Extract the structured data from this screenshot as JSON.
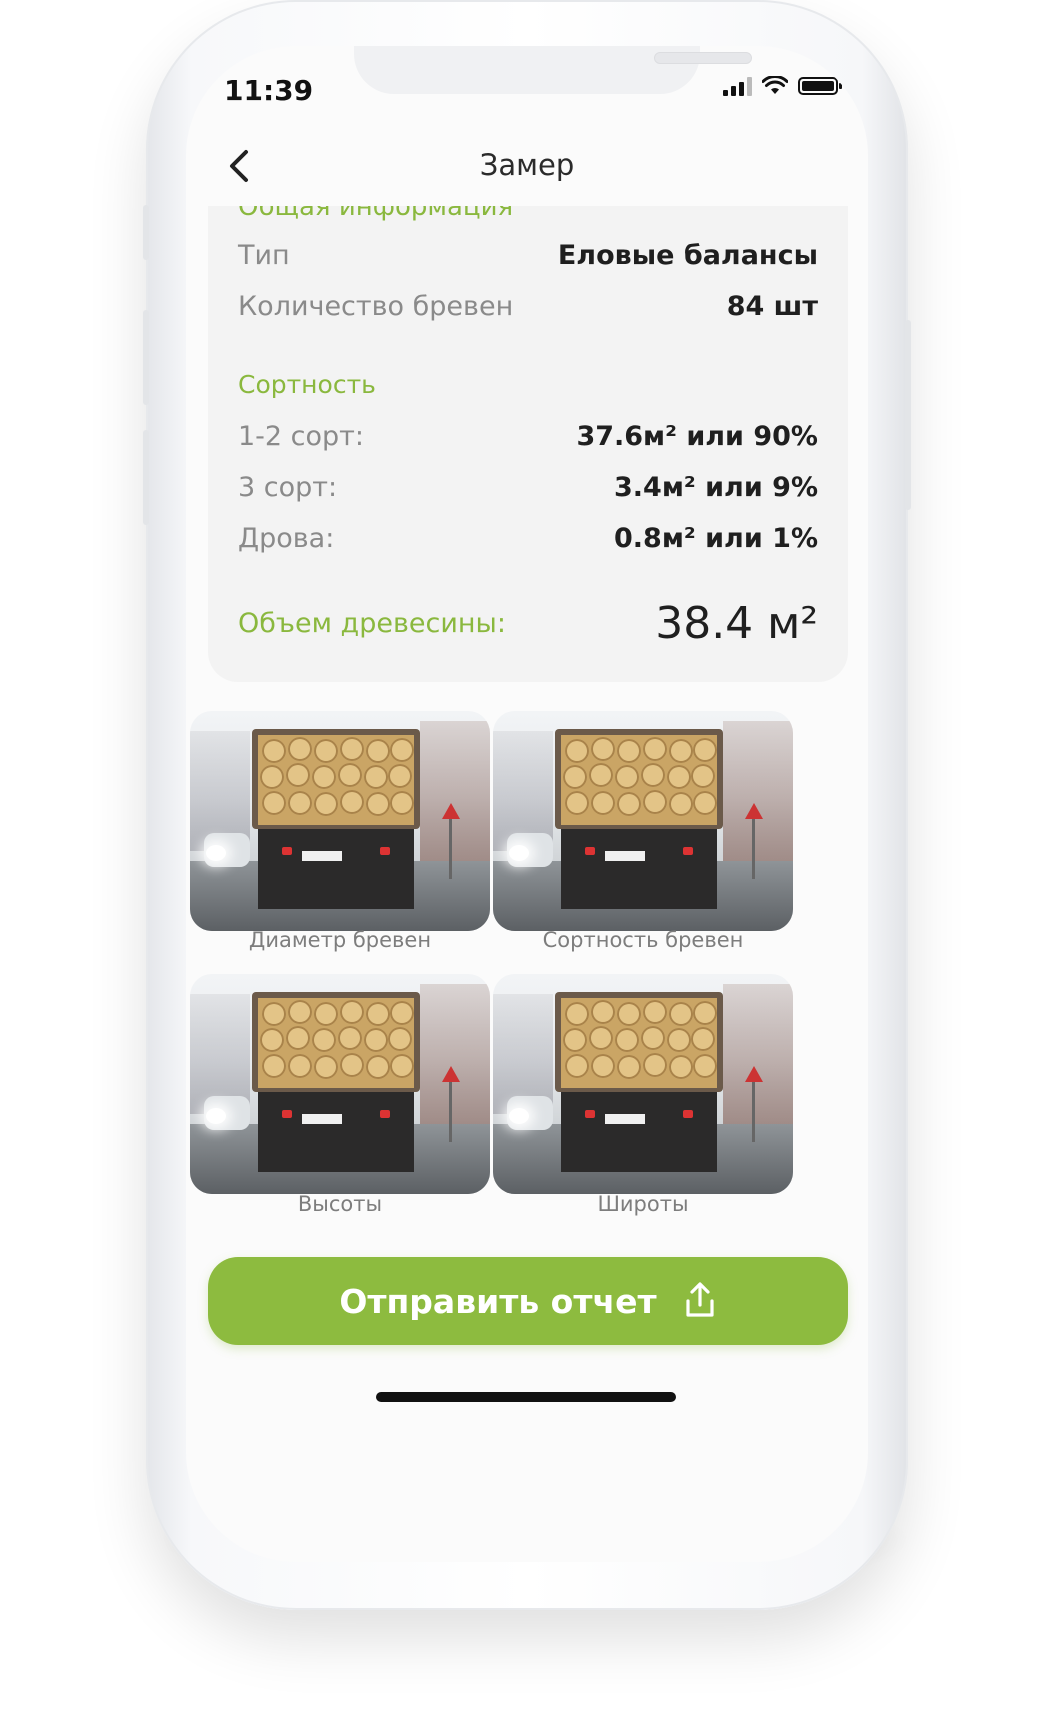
{
  "status_bar": {
    "time": "11:39"
  },
  "header": {
    "title": "Замер"
  },
  "card": {
    "section_title": "Общая информация",
    "rows": [
      {
        "label": "Тип",
        "value": "Еловые балансы"
      },
      {
        "label": "Количество бревен",
        "value": "84 шт"
      }
    ],
    "grade_title": "Сортность",
    "grades": [
      {
        "label": "1-2 сорт:",
        "value": "37.6м² или 90%"
      },
      {
        "label": "3 сорт:",
        "value": "3.4м² или 9%"
      },
      {
        "label": "Дрова:",
        "value": "0.8м² или 1%"
      }
    ],
    "volume": {
      "label": "Объем древесины:",
      "value": "38.4 м²"
    }
  },
  "photos": [
    {
      "caption": "Диаметр бревен"
    },
    {
      "caption": "Сортность бревен"
    },
    {
      "caption": "Высоты"
    },
    {
      "caption": "Широты"
    }
  ],
  "send_button": {
    "label": "Отправить отчет"
  },
  "colors": {
    "accent": "#8dbb3f",
    "card_bg": "#f3f3f3",
    "label": "#8a8a8a"
  }
}
